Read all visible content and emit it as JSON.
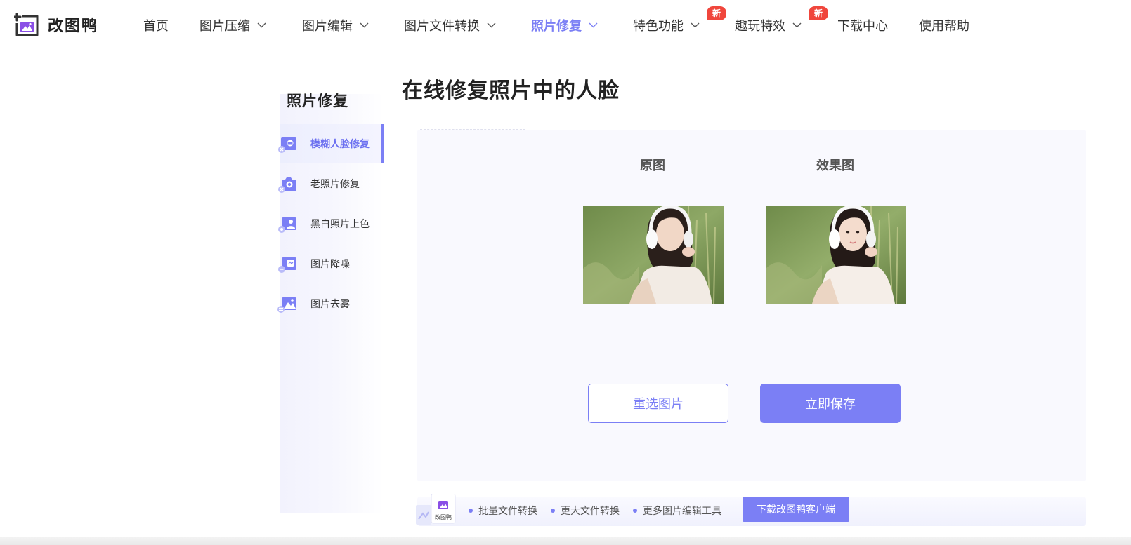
{
  "brand": {
    "name": "改图鸭"
  },
  "nav": {
    "items": [
      {
        "label": "首页"
      },
      {
        "label": "图片压缩"
      },
      {
        "label": "图片编辑"
      },
      {
        "label": "图片文件转换"
      },
      {
        "label": "照片修复",
        "active": true
      },
      {
        "label": "特色功能",
        "badge": "新"
      },
      {
        "label": "趣玩特效",
        "badge": "新"
      },
      {
        "label": "下载中心"
      },
      {
        "label": "使用帮助"
      }
    ]
  },
  "sidebar": {
    "title": "照片修复",
    "items": [
      {
        "label": "模糊人脸修复",
        "icon": "face-restore-icon",
        "active": true
      },
      {
        "label": "老照片修复",
        "icon": "camera-restore-icon"
      },
      {
        "label": "黑白照片上色",
        "icon": "colorize-icon"
      },
      {
        "label": "图片降噪",
        "icon": "denoise-icon"
      },
      {
        "label": "图片去雾",
        "icon": "dehaze-icon"
      }
    ]
  },
  "main": {
    "title": "在线修复照片中的人脸",
    "original_label": "原图",
    "result_label": "效果图",
    "reselect_label": "重选图片",
    "save_label": "立即保存"
  },
  "promo": {
    "app_caption": "改图鸭",
    "features": [
      "批量文件转换",
      "更大文件转换",
      "更多图片编辑工具"
    ],
    "download_label": "下载改图鸭客户端"
  },
  "colors": {
    "accent": "#7b7ff5",
    "badge": "#f0463c",
    "panel_bg": "#f9f9fe"
  }
}
